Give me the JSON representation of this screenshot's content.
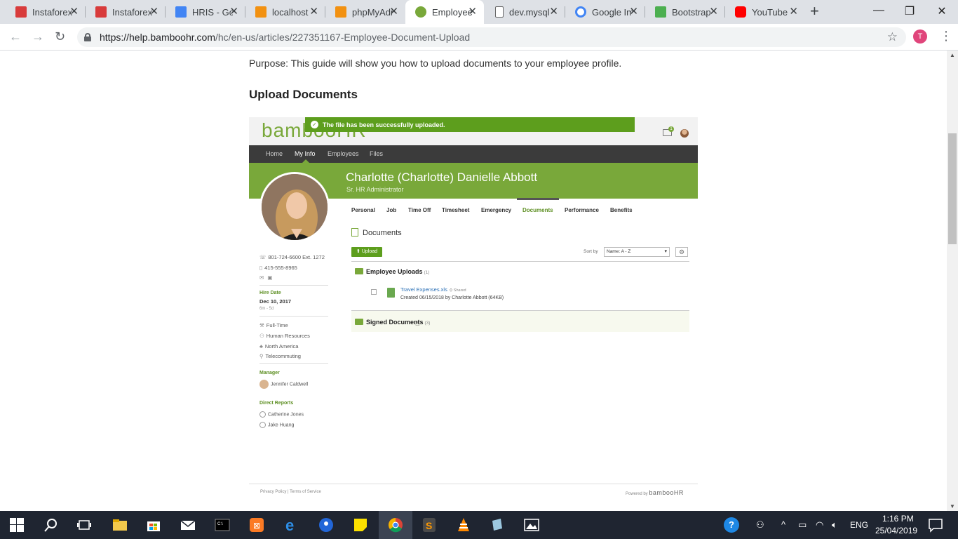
{
  "browser": {
    "tabs": [
      {
        "title": "Instaforex",
        "icon": "instaforex-icon",
        "color": "#d83b3b"
      },
      {
        "title": "Instaforex",
        "icon": "instaforex-icon",
        "color": "#d83b3b"
      },
      {
        "title": "HRIS - Google Docs",
        "icon": "google-docs-icon",
        "color": "#4285f4"
      },
      {
        "title": "localhost",
        "icon": "phpmyadmin-icon",
        "color": "#f29111"
      },
      {
        "title": "phpMyAdmin",
        "icon": "phpmyadmin-icon",
        "color": "#f29111"
      },
      {
        "title": "Employee Document Upload",
        "icon": "bamboohr-icon",
        "color": "#79a83a",
        "active": true
      },
      {
        "title": "dev.mysql",
        "icon": "page-icon",
        "color": "#888888"
      },
      {
        "title": "Google Images",
        "icon": "google-icon",
        "color": "#4285f4"
      },
      {
        "title": "Bootstrap",
        "icon": "w3schools-icon",
        "color": "#4caf50"
      },
      {
        "title": "YouTube",
        "icon": "youtube-icon",
        "color": "#ff0000"
      }
    ],
    "url_host": "https://help.bamboohr.com",
    "url_path": "/hc/en-us/articles/227351167-Employee-Document-Upload",
    "profile_initial": "T"
  },
  "article": {
    "purpose": "Purpose: This guide will show you how to upload documents to your employee profile.",
    "heading": "Upload Documents"
  },
  "bamboo": {
    "logo": "bambooHR",
    "toast": "The file has been successfully uploaded.",
    "inbox_count": "1",
    "nav": [
      "Home",
      "My Info",
      "Employees",
      "Files"
    ],
    "employee_name": "Charlotte (Charlotte) Danielle Abbott",
    "employee_title": "Sr. HR Administrator",
    "subtabs": [
      "Personal",
      "Job",
      "Time Off",
      "Timesheet",
      "Emergency",
      "Documents",
      "Performance",
      "Benefits"
    ],
    "contact": {
      "work_phone": "801-724-6600 Ext. 1272",
      "mobile_phone": "415-555-8965"
    },
    "hire_date_label": "Hire Date",
    "hire_date": "Dec 10, 2017",
    "tenure": "6m - 5d",
    "details": [
      "Full-Time",
      "Human Resources",
      "North America",
      "Telecommuting"
    ],
    "manager_label": "Manager",
    "manager": "Jennifer Caldwell",
    "direct_reports_label": "Direct Reports",
    "direct_reports": [
      "Catherine Jones",
      "Jake Huang"
    ],
    "documents_heading": "Documents",
    "upload_button": "Upload",
    "sort_label": "Sort by",
    "sort_value": "Name: A - Z",
    "folder1": {
      "name": "Employee Uploads",
      "count": "(1)"
    },
    "file": {
      "name": "Travel Expenses.xls",
      "shared": "Shared",
      "meta": "Created 06/15/2018 by Charlotte Abbott (64KB)"
    },
    "folder2": {
      "name": "Signed Documents",
      "count": "(3)"
    },
    "footer_links": "Privacy Policy  |  Terms of Service",
    "powered_by": "Powered by",
    "powered_logo": "bambooHR"
  },
  "taskbar": {
    "language": "ENG",
    "time": "1:16 PM",
    "date": "25/04/2019"
  }
}
